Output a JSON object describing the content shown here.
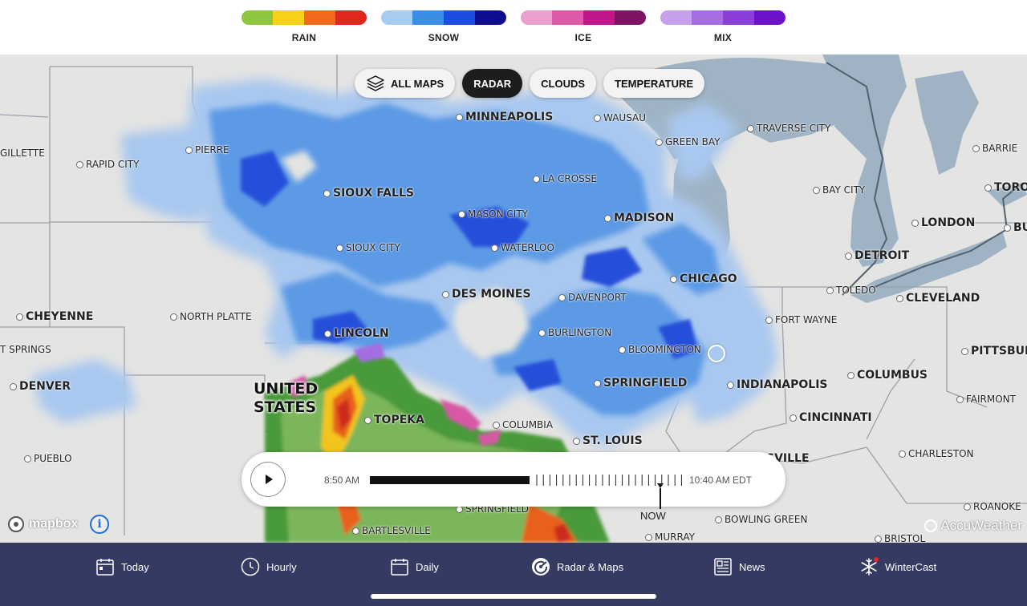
{
  "legend": [
    {
      "label": "RAIN",
      "colors": [
        "#8dc63f",
        "#f7d117",
        "#f26b1d",
        "#e0281f"
      ]
    },
    {
      "label": "SNOW",
      "colors": [
        "#a8ccf0",
        "#3b8ee6",
        "#1b4de3",
        "#0e0e8c"
      ]
    },
    {
      "label": "ICE",
      "colors": [
        "#eaa0cc",
        "#dc5aa8",
        "#c0178a",
        "#7d1462"
      ]
    },
    {
      "label": "MIX",
      "colors": [
        "#c6a0ea",
        "#a66de3",
        "#8b3fd9",
        "#6b13c9"
      ]
    }
  ],
  "map_types": {
    "all_maps": "ALL MAPS",
    "radar": "RADAR",
    "clouds": "CLOUDS",
    "temperature": "TEMPERATURE",
    "selected": "RADAR"
  },
  "country_label": {
    "line1": "UNITED",
    "line2": "STATES"
  },
  "cities": {
    "minneapolis": "MINNEAPOLIS",
    "wausau": "WAUSAU",
    "traverse_city": "TRAVERSE CITY",
    "green_bay": "GREEN BAY",
    "barrie": "BARRIE",
    "gillette": "GILLETTE",
    "pierre": "PIERRE",
    "rapid_city": "RAPID CITY",
    "la_crosse": "LA CROSSE",
    "bay_city": "BAY CITY",
    "toronto": "TORON",
    "sioux_falls": "SIOUX FALLS",
    "mason_city": "MASON CITY",
    "madison": "MADISON",
    "london": "LONDON",
    "buffalo": "BU",
    "sioux_city": "SIOUX CITY",
    "waterloo": "WATERLOO",
    "detroit": "DETROIT",
    "chicago": "CHICAGO",
    "toledo": "TOLEDO",
    "des_moines": "DES MOINES",
    "davenport": "DAVENPORT",
    "cleveland": "CLEVELAND",
    "cheyenne": "CHEYENNE",
    "north_platte": "NORTH PLATTE",
    "fort_wayne": "FORT WAYNE",
    "lincoln": "LINCOLN",
    "burlington": "BURLINGTON",
    "t_springs": "T SPRINGS",
    "bloomington": "BLOOMINGTON",
    "pittsburgh": "PITTSBURG",
    "columbus": "COLUMBUS",
    "denver": "DENVER",
    "springfield_il": "SPRINGFIELD",
    "indianapolis": "INDIANAPOLIS",
    "fairmont": "FAIRMONT",
    "topeka": "TOPEKA",
    "cincinnati": "CINCINNATI",
    "columbia": "COLUMBIA",
    "st_louis": "ST. LOUIS",
    "pueblo": "PUEBLO",
    "louisville": "SVILLE",
    "charleston": "CHARLESTON",
    "springfield_mo": "SPRINGFIELD",
    "roanoke": "ROANOKE",
    "bartlesville": "BARTLESVILLE",
    "bowling_green": "BOWLING GREEN",
    "murray": "MURRAY",
    "bristol": "BRISTOL"
  },
  "timeline": {
    "start_time": "8:50 AM",
    "end_time": "10:40 AM EDT",
    "now_label": "NOW",
    "progress": 0.51,
    "play_icon": "play-icon"
  },
  "branding": {
    "mapbox": "mapbox",
    "accuweather": "AccuWeather"
  },
  "nav": [
    {
      "label": "Today",
      "icon": "calendar-icon"
    },
    {
      "label": "Hourly",
      "icon": "clock-icon"
    },
    {
      "label": "Daily",
      "icon": "calendar-grid-icon"
    },
    {
      "label": "Radar & Maps",
      "icon": "radar-icon",
      "active": true
    },
    {
      "label": "News",
      "icon": "newspaper-icon"
    },
    {
      "label": "WinterCast",
      "icon": "snowflake-icon",
      "badge": true
    }
  ]
}
